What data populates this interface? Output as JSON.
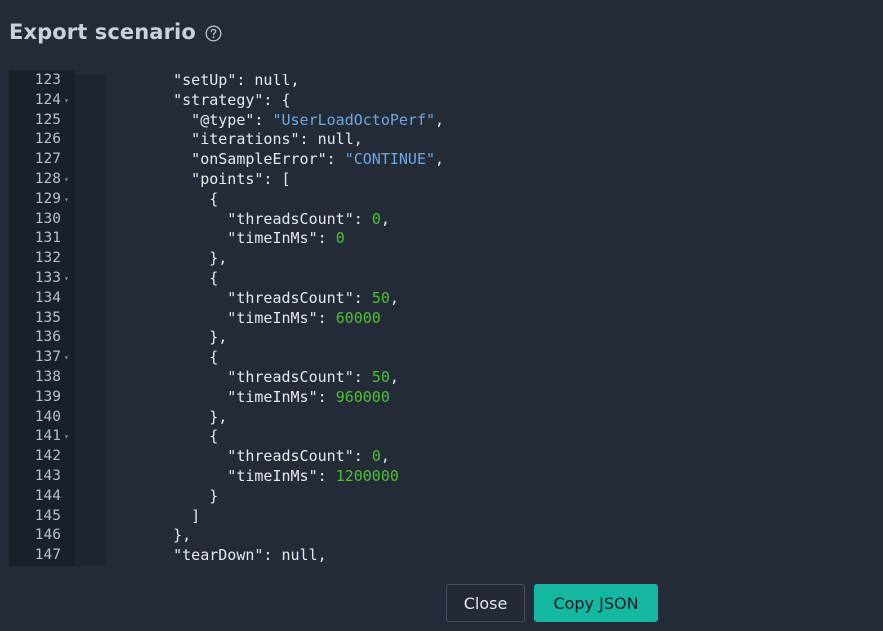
{
  "dialog": {
    "title": "Export scenario",
    "help_icon": "question-circle-icon"
  },
  "editor": {
    "lines": [
      {
        "num": "123",
        "fold": false,
        "tokens": [
          [
            "p",
            "    \""
          ],
          [
            "k",
            "setUp"
          ],
          [
            "p",
            "\": null,"
          ]
        ]
      },
      {
        "num": "124",
        "fold": true,
        "tokens": [
          [
            "p",
            "    \""
          ],
          [
            "k",
            "strategy"
          ],
          [
            "p",
            "\": {"
          ]
        ]
      },
      {
        "num": "125",
        "fold": false,
        "tokens": [
          [
            "p",
            "      \""
          ],
          [
            "k",
            "@type"
          ],
          [
            "p",
            "\": "
          ],
          [
            "s",
            "\"UserLoadOctoPerf\""
          ],
          [
            "p",
            ","
          ]
        ]
      },
      {
        "num": "126",
        "fold": false,
        "tokens": [
          [
            "p",
            "      \""
          ],
          [
            "k",
            "iterations"
          ],
          [
            "p",
            "\": null,"
          ]
        ]
      },
      {
        "num": "127",
        "fold": false,
        "tokens": [
          [
            "p",
            "      \""
          ],
          [
            "k",
            "onSampleError"
          ],
          [
            "p",
            "\": "
          ],
          [
            "s",
            "\"CONTINUE\""
          ],
          [
            "p",
            ","
          ]
        ]
      },
      {
        "num": "128",
        "fold": true,
        "tokens": [
          [
            "p",
            "      \""
          ],
          [
            "k",
            "points"
          ],
          [
            "p",
            "\": ["
          ]
        ]
      },
      {
        "num": "129",
        "fold": true,
        "tokens": [
          [
            "p",
            "        {"
          ]
        ]
      },
      {
        "num": "130",
        "fold": false,
        "tokens": [
          [
            "p",
            "          \""
          ],
          [
            "k",
            "threadsCount"
          ],
          [
            "p",
            "\": "
          ],
          [
            "n",
            "0"
          ],
          [
            "p",
            ","
          ]
        ]
      },
      {
        "num": "131",
        "fold": false,
        "tokens": [
          [
            "p",
            "          \""
          ],
          [
            "k",
            "timeInMs"
          ],
          [
            "p",
            "\": "
          ],
          [
            "n",
            "0"
          ]
        ]
      },
      {
        "num": "132",
        "fold": false,
        "tokens": [
          [
            "p",
            "        },"
          ]
        ]
      },
      {
        "num": "133",
        "fold": true,
        "tokens": [
          [
            "p",
            "        {"
          ]
        ]
      },
      {
        "num": "134",
        "fold": false,
        "tokens": [
          [
            "p",
            "          \""
          ],
          [
            "k",
            "threadsCount"
          ],
          [
            "p",
            "\": "
          ],
          [
            "n",
            "50"
          ],
          [
            "p",
            ","
          ]
        ]
      },
      {
        "num": "135",
        "fold": false,
        "tokens": [
          [
            "p",
            "          \""
          ],
          [
            "k",
            "timeInMs"
          ],
          [
            "p",
            "\": "
          ],
          [
            "n",
            "60000"
          ]
        ]
      },
      {
        "num": "136",
        "fold": false,
        "tokens": [
          [
            "p",
            "        },"
          ]
        ]
      },
      {
        "num": "137",
        "fold": true,
        "tokens": [
          [
            "p",
            "        {"
          ]
        ]
      },
      {
        "num": "138",
        "fold": false,
        "tokens": [
          [
            "p",
            "          \""
          ],
          [
            "k",
            "threadsCount"
          ],
          [
            "p",
            "\": "
          ],
          [
            "n",
            "50"
          ],
          [
            "p",
            ","
          ]
        ]
      },
      {
        "num": "139",
        "fold": false,
        "tokens": [
          [
            "p",
            "          \""
          ],
          [
            "k",
            "timeInMs"
          ],
          [
            "p",
            "\": "
          ],
          [
            "n",
            "960000"
          ]
        ]
      },
      {
        "num": "140",
        "fold": false,
        "tokens": [
          [
            "p",
            "        },"
          ]
        ]
      },
      {
        "num": "141",
        "fold": true,
        "tokens": [
          [
            "p",
            "        {"
          ]
        ]
      },
      {
        "num": "142",
        "fold": false,
        "tokens": [
          [
            "p",
            "          \""
          ],
          [
            "k",
            "threadsCount"
          ],
          [
            "p",
            "\": "
          ],
          [
            "n",
            "0"
          ],
          [
            "p",
            ","
          ]
        ]
      },
      {
        "num": "143",
        "fold": false,
        "tokens": [
          [
            "p",
            "          \""
          ],
          [
            "k",
            "timeInMs"
          ],
          [
            "p",
            "\": "
          ],
          [
            "n",
            "1200000"
          ]
        ]
      },
      {
        "num": "144",
        "fold": false,
        "tokens": [
          [
            "p",
            "        }"
          ]
        ]
      },
      {
        "num": "145",
        "fold": false,
        "tokens": [
          [
            "p",
            "      ]"
          ]
        ]
      },
      {
        "num": "146",
        "fold": false,
        "tokens": [
          [
            "p",
            "    },"
          ]
        ]
      },
      {
        "num": "147",
        "fold": false,
        "tokens": [
          [
            "p",
            "    \""
          ],
          [
            "k",
            "tearDown"
          ],
          [
            "p",
            "\": null,"
          ]
        ]
      }
    ]
  },
  "footer": {
    "close_label": "Close",
    "copy_label": "Copy JSON"
  },
  "colors": {
    "background": "#222b37",
    "gutter": "#1a2029",
    "string": "#6fa8e0",
    "number": "#4fbf34",
    "primary_button": "#14b8a0"
  }
}
